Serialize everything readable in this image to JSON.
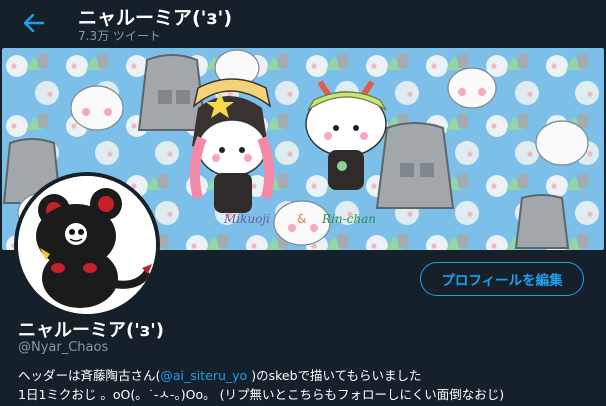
{
  "topbar": {
    "title": "ニャルーミア('з')",
    "tweet_count": "7.3万 ツイート"
  },
  "header_art": {
    "caption_left": "Mikuoji",
    "caption_amp": "&",
    "caption_right": "Rin-chan"
  },
  "profile": {
    "edit_button_label": "プロフィールを編集",
    "display_name": "ニャルーミア('з')",
    "handle": "@Nyar_Chaos",
    "bio_line1_before": "ヘッダーは斉藤陶古さん(",
    "bio_line1_mention": "@ai_siteru_yo",
    "bio_line1_after": " )のskebで描いてもらいました",
    "bio_line2": "1日1ミクおじ 。oO(。˙-ㅅ-。)Oo。 (リプ無いとこちらもフォローしにくい面倒なおじ)"
  },
  "colors": {
    "background": "#15202b",
    "accent": "#1da1f2",
    "muted": "#8899a6",
    "header_bg": "#6fb6e6"
  }
}
